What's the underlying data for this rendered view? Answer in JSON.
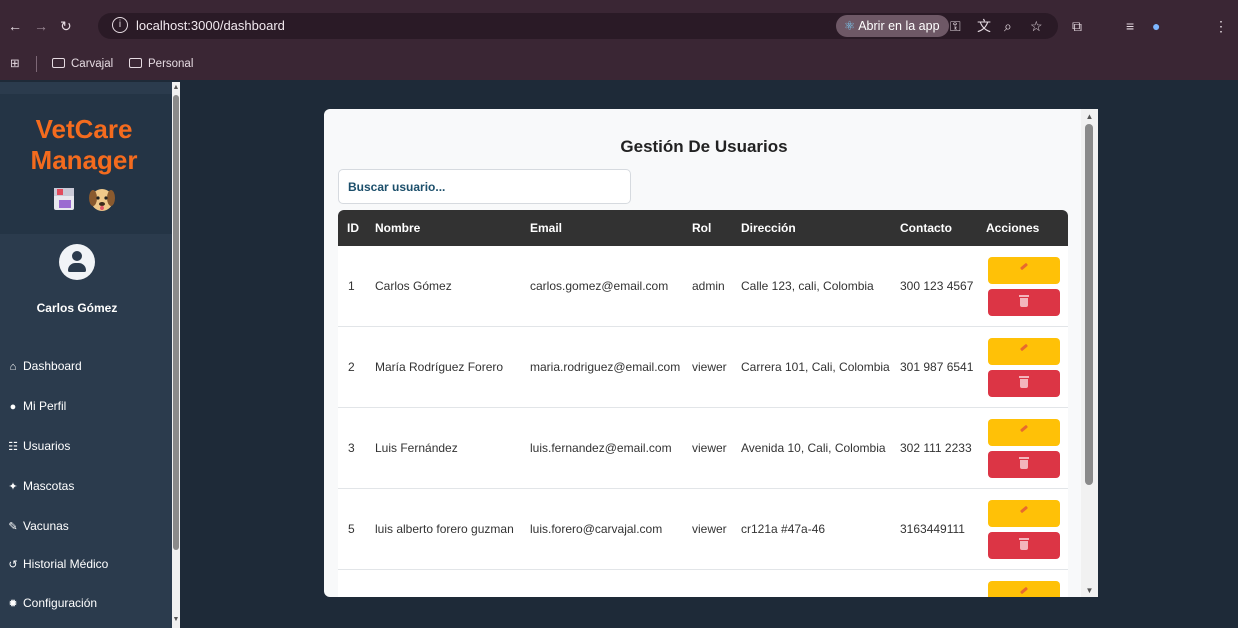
{
  "browser": {
    "url": "localhost:3000/dashboard",
    "open_in_app": "Abrir en la app",
    "bookmarks": [
      "Carvajal",
      "Personal"
    ]
  },
  "sidebar": {
    "logo_line1": "VetCare",
    "logo_line2": "Manager",
    "user_name": "Carlos Gómez",
    "items": [
      {
        "label": "Dashboard",
        "icon": "home-icon"
      },
      {
        "label": "Mi Perfil",
        "icon": "user-icon"
      },
      {
        "label": "Usuarios",
        "icon": "users-icon"
      },
      {
        "label": "Mascotas",
        "icon": "paw-icon"
      },
      {
        "label": "Vacunas",
        "icon": "syringe-icon"
      },
      {
        "label": "Historial Médico",
        "icon": "history-icon"
      },
      {
        "label": "Configuración",
        "icon": "gear-icon"
      }
    ]
  },
  "main": {
    "title": "Gestión De Usuarios",
    "search_placeholder": "Buscar usuario...",
    "columns": [
      "ID",
      "Nombre",
      "Email",
      "Rol",
      "Dirección",
      "Contacto",
      "Acciones"
    ],
    "rows": [
      {
        "id": "1",
        "nombre": "Carlos Gómez",
        "email": "carlos.gomez@email.com",
        "rol": "admin",
        "direccion": "Calle 123, cali, Colombia",
        "contacto": "300 123 4567"
      },
      {
        "id": "2",
        "nombre": "María Rodríguez Forero",
        "email": "maria.rodriguez@email.com",
        "rol": "viewer",
        "direccion": "Carrera 101, Cali, Colombia",
        "contacto": "301 987 6541"
      },
      {
        "id": "3",
        "nombre": "Luis Fernández",
        "email": "luis.fernandez@email.com",
        "rol": "viewer",
        "direccion": "Avenida 10, Cali, Colombia",
        "contacto": "302 111 2233"
      },
      {
        "id": "5",
        "nombre": "luis alberto forero guzman",
        "email": "luis.forero@carvajal.com",
        "rol": "viewer",
        "direccion": "cr121a #47a-46",
        "contacto": "3163449111"
      }
    ]
  },
  "colors": {
    "brand": "#f46b1e",
    "edit": "#ffc107",
    "delete": "#dc3545",
    "sidebar": "#2b3b4d",
    "table_header": "#323232"
  }
}
